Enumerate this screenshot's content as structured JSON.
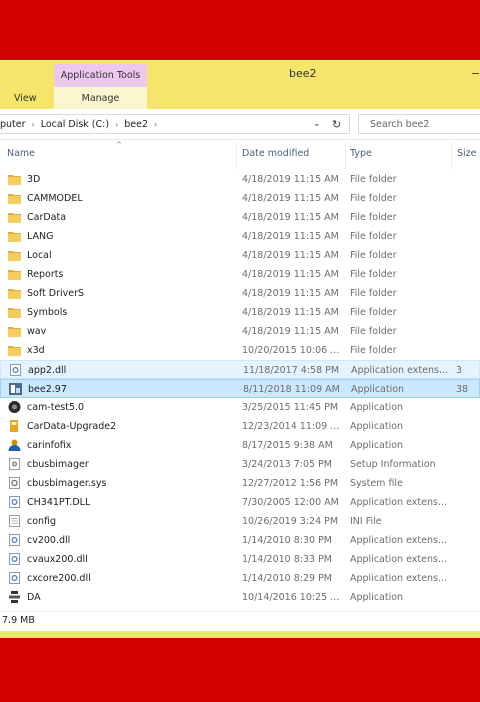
{
  "window": {
    "title": "bee2",
    "context_tab_group": "Application Tools",
    "minimize_glyph": "−",
    "colors": {
      "titlebar": "#f5e56a",
      "context_tab": "#ecc8ee",
      "background": "#d40000",
      "selection": "#cce8ff"
    }
  },
  "ribbon": {
    "tabs": [
      {
        "label": "View"
      },
      {
        "label": "Manage"
      }
    ]
  },
  "address": {
    "crumbs": [
      "puter",
      "Local Disk (C:)",
      "bee2"
    ],
    "separator": "›",
    "dropdown_glyph": "⌄",
    "refresh_glyph": "↻",
    "search_placeholder": "Search bee2"
  },
  "columns": {
    "name": "Name",
    "date": "Date modified",
    "type": "Type",
    "size": "Size",
    "sort_glyph": "^"
  },
  "files": [
    {
      "name": "3D",
      "date": "4/18/2019 11:15 AM",
      "type": "File folder",
      "size": "",
      "icon": "folder-icon",
      "state": ""
    },
    {
      "name": "CAMMODEL",
      "date": "4/18/2019 11:15 AM",
      "type": "File folder",
      "size": "",
      "icon": "folder-icon",
      "state": ""
    },
    {
      "name": "CarData",
      "date": "4/18/2019 11:15 AM",
      "type": "File folder",
      "size": "",
      "icon": "folder-icon",
      "state": ""
    },
    {
      "name": "LANG",
      "date": "4/18/2019 11:15 AM",
      "type": "File folder",
      "size": "",
      "icon": "folder-icon",
      "state": ""
    },
    {
      "name": "Local",
      "date": "4/18/2019 11:15 AM",
      "type": "File folder",
      "size": "",
      "icon": "folder-icon",
      "state": ""
    },
    {
      "name": "Reports",
      "date": "4/18/2019 11:15 AM",
      "type": "File folder",
      "size": "",
      "icon": "folder-icon",
      "state": ""
    },
    {
      "name": "Soft DriverS",
      "date": "4/18/2019 11:15 AM",
      "type": "File folder",
      "size": "",
      "icon": "folder-icon",
      "state": ""
    },
    {
      "name": "Symbols",
      "date": "4/18/2019 11:15 AM",
      "type": "File folder",
      "size": "",
      "icon": "folder-icon",
      "state": ""
    },
    {
      "name": "wav",
      "date": "4/18/2019 11:15 AM",
      "type": "File folder",
      "size": "",
      "icon": "folder-icon",
      "state": ""
    },
    {
      "name": "x3d",
      "date": "10/20/2015 10:06 ...",
      "type": "File folder",
      "size": "",
      "icon": "folder-icon",
      "state": ""
    },
    {
      "name": "app2.dll",
      "date": "11/18/2017 4:58 PM",
      "type": "Application extens...",
      "size": "3",
      "icon": "dll-icon",
      "state": "hover"
    },
    {
      "name": "bee2.97",
      "date": "8/11/2018 11:09 AM",
      "type": "Application",
      "size": "38",
      "icon": "app-icon",
      "state": "selected"
    },
    {
      "name": "cam-test5.0",
      "date": "3/25/2015 11:45 PM",
      "type": "Application",
      "size": "",
      "icon": "camera-icon",
      "state": ""
    },
    {
      "name": "CarData-Upgrade2",
      "date": "12/23/2014 11:09 ...",
      "type": "Application",
      "size": "",
      "icon": "upgrade-icon",
      "state": ""
    },
    {
      "name": "carinfofix",
      "date": "8/17/2015 9:38 AM",
      "type": "Application",
      "size": "",
      "icon": "user-icon",
      "state": ""
    },
    {
      "name": "cbusbimager",
      "date": "3/24/2013 7:05 PM",
      "type": "Setup Information",
      "size": "",
      "icon": "setup-icon",
      "state": ""
    },
    {
      "name": "cbusbimager.sys",
      "date": "12/27/2012 1:56 PM",
      "type": "System file",
      "size": "",
      "icon": "sysfile-icon",
      "state": ""
    },
    {
      "name": "CH341PT.DLL",
      "date": "7/30/2005 12:00 AM",
      "type": "Application extens...",
      "size": "",
      "icon": "dll-icon",
      "state": ""
    },
    {
      "name": "config",
      "date": "10/26/2019 3:24 PM",
      "type": "INI File",
      "size": "",
      "icon": "ini-icon",
      "state": ""
    },
    {
      "name": "cv200.dll",
      "date": "1/14/2010 8:30 PM",
      "type": "Application extens...",
      "size": "",
      "icon": "dll-icon",
      "state": ""
    },
    {
      "name": "cvaux200.dll",
      "date": "1/14/2010 8:33 PM",
      "type": "Application extens...",
      "size": "",
      "icon": "dll-icon",
      "state": ""
    },
    {
      "name": "cxcore200.dll",
      "date": "1/14/2010 8:29 PM",
      "type": "Application extens...",
      "size": "",
      "icon": "dll-icon",
      "state": ""
    },
    {
      "name": "DA",
      "date": "10/14/2016 10:25 ...",
      "type": "Application",
      "size": "",
      "icon": "network-icon",
      "state": ""
    }
  ],
  "status": {
    "text": "7.9 MB"
  }
}
